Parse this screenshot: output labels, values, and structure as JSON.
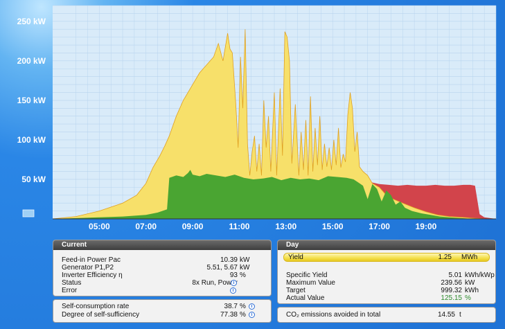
{
  "chart_data": {
    "type": "area",
    "y_ticks": [
      "250 kW",
      "200 kW",
      "150 kW",
      "100 kW",
      "50 kW"
    ],
    "y_tick_values": [
      250,
      200,
      150,
      100,
      50
    ],
    "x_ticks": [
      "05:00",
      "07:00",
      "09:00",
      "11:00",
      "13:00",
      "15:00",
      "17:00",
      "19:00"
    ],
    "x_tick_values": [
      5,
      7,
      9,
      11,
      13,
      15,
      17,
      19
    ],
    "xlim": [
      3.0,
      22.0
    ],
    "ylim": [
      0,
      270
    ],
    "grid": true,
    "colors": {
      "generation": "#f7e06a",
      "self_consumption": "#4aa532",
      "purchased": "#d2444b",
      "plot_bg": "#d9ebf9",
      "grid": "#b8d4ee"
    },
    "series": [
      {
        "key": "generation",
        "x": [
          3.0,
          4.0,
          5.0,
          6.0,
          6.6,
          7.0,
          7.3,
          7.6,
          7.8,
          8.0,
          8.3,
          8.6,
          9.0,
          9.3,
          9.6,
          9.9,
          10.1,
          10.3,
          10.5,
          10.6,
          10.7,
          10.85,
          10.95,
          11.05,
          11.15,
          11.25,
          11.35,
          11.45,
          11.55,
          11.65,
          11.75,
          11.85,
          11.95,
          12.05,
          12.15,
          12.25,
          12.35,
          12.5,
          12.6,
          12.75,
          12.85,
          12.95,
          13.05,
          13.15,
          13.25,
          13.4,
          13.55,
          13.65,
          13.75,
          13.85,
          13.95,
          14.05,
          14.15,
          14.25,
          14.35,
          14.45,
          14.55,
          14.65,
          14.75,
          14.85,
          14.95,
          15.05,
          15.15,
          15.25,
          15.35,
          15.45,
          15.55,
          15.65,
          15.75,
          15.85,
          15.95,
          16.05,
          16.15,
          16.3,
          16.5,
          16.7,
          17.0,
          17.3,
          17.6,
          18.0,
          18.5,
          19.0,
          19.5,
          20.0,
          20.5,
          21.0,
          21.5,
          22.0
        ],
        "y": [
          0,
          3,
          10,
          20,
          30,
          45,
          65,
          80,
          92,
          105,
          130,
          150,
          170,
          185,
          195,
          205,
          222,
          200,
          235,
          215,
          210,
          145,
          90,
          205,
          140,
          240,
          95,
          55,
          85,
          105,
          60,
          95,
          55,
          150,
          90,
          130,
          60,
          160,
          55,
          165,
          80,
          237,
          230,
          200,
          70,
          145,
          55,
          110,
          62,
          125,
          55,
          155,
          60,
          115,
          68,
          130,
          62,
          95,
          66,
          90,
          62,
          100,
          68,
          115,
          65,
          82,
          72,
          132,
          160,
          140,
          85,
          110,
          66,
          60,
          55,
          45,
          40,
          30,
          25,
          20,
          14,
          9,
          5,
          3,
          2,
          1,
          0,
          0
        ]
      },
      {
        "key": "self_consumption",
        "x": [
          3.0,
          5.0,
          6.0,
          7.0,
          7.5,
          7.9,
          8.0,
          8.3,
          8.6,
          8.8,
          8.9,
          9.0,
          9.3,
          9.6,
          10.0,
          10.4,
          10.8,
          11.2,
          11.6,
          12.0,
          12.4,
          12.8,
          13.2,
          13.6,
          14.0,
          14.4,
          14.8,
          15.2,
          15.6,
          15.9,
          16.1,
          16.3,
          16.5,
          16.7,
          16.9,
          17.1,
          17.3,
          17.5,
          17.7,
          17.9,
          18.1,
          18.4,
          18.8,
          19.2,
          19.6,
          20.0,
          20.5,
          21.0,
          22.0
        ],
        "y": [
          0,
          2,
          3,
          5,
          8,
          12,
          52,
          55,
          53,
          58,
          62,
          56,
          54,
          57,
          55,
          53,
          56,
          52,
          50,
          51,
          53,
          49,
          52,
          50,
          51,
          49,
          54,
          53,
          52,
          50,
          46,
          42,
          25,
          44,
          38,
          22,
          36,
          30,
          18,
          22,
          14,
          10,
          7,
          5,
          3,
          2,
          1,
          0,
          0
        ]
      },
      {
        "key": "purchased",
        "x": [
          16.1,
          16.4,
          16.7,
          17.0,
          17.4,
          17.8,
          18.2,
          18.6,
          19.0,
          19.4,
          19.8,
          20.2,
          20.6,
          20.9,
          21.1,
          21.3,
          21.5,
          22.0
        ],
        "y": [
          45,
          47,
          46,
          44,
          43,
          42,
          43,
          42,
          42,
          43,
          42,
          42,
          43,
          43,
          42,
          6,
          2,
          0
        ]
      }
    ]
  },
  "current": {
    "title": "Current",
    "rows": [
      {
        "label": "Feed-in Power Pac",
        "value": "10.39",
        "unit": "kW",
        "info": false
      },
      {
        "label": "Generator P1,P2",
        "value": "5.51, 5.67",
        "unit": "kW",
        "info": false
      },
      {
        "label": "Inverter Efficiency η",
        "value": "93",
        "unit": "%",
        "info": false
      },
      {
        "label": "Status",
        "value": "8x Run, Power",
        "unit": "",
        "info": true
      },
      {
        "label": "Error",
        "value": "",
        "unit": "",
        "info": true
      }
    ]
  },
  "consumption": {
    "rows": [
      {
        "label": "Self-consumption rate",
        "value": "38.7",
        "unit": "%",
        "info": true
      },
      {
        "label": "Degree of self-sufficiency",
        "value": "77.38",
        "unit": "%",
        "info": true
      }
    ]
  },
  "day": {
    "title": "Day",
    "yield": {
      "label": "Yield",
      "value": "1.25",
      "unit": "MWh"
    },
    "rows": [
      {
        "label": "Specific Yield",
        "value": "5.01",
        "unit": "kWh/kWp",
        "green": false
      },
      {
        "label": "Maximum Value",
        "value": "239.56",
        "unit": "kW",
        "green": false
      },
      {
        "label": "Target",
        "value": "999.32",
        "unit": "kWh",
        "green": false
      },
      {
        "label": "Actual Value",
        "value": "125.15",
        "unit": "%",
        "green": true
      }
    ]
  },
  "co2": {
    "label": "CO₂ emissions avoided in total",
    "value": "14.55",
    "unit": "t"
  }
}
